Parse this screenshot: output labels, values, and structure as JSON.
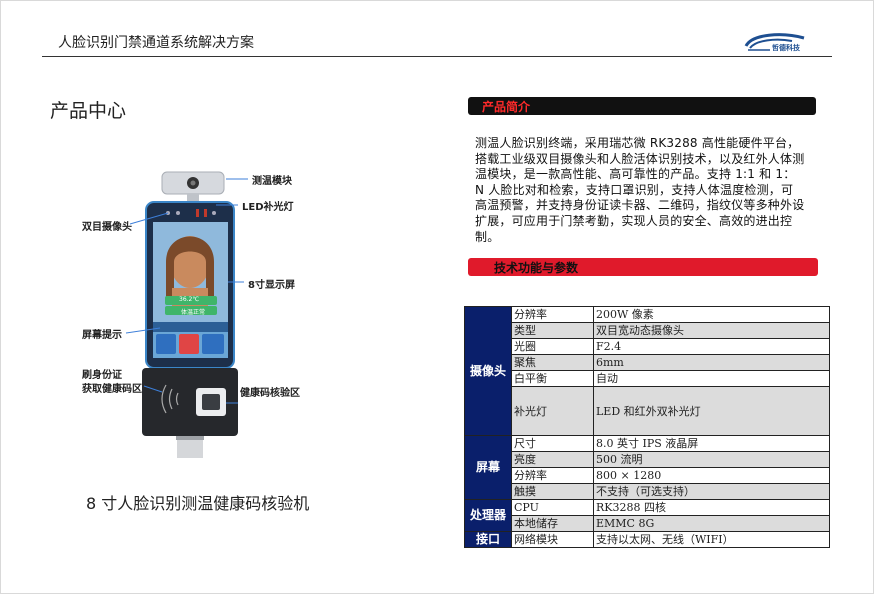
{
  "header": {
    "title": "人脸识别门禁通道系统解决方案",
    "logo_text": "哲德科技"
  },
  "left": {
    "section_title": "产品中心",
    "product_caption": "8 寸人脸识别测温健康码核验机",
    "callouts": {
      "temp_module": "测温模块",
      "led_fill": "LED补光灯",
      "dual_camera": "双目摄像头",
      "display": "8寸显示屏",
      "screen_tip": "屏幕提示",
      "id_card_line1": "刷身份证",
      "id_card_line2": "获取健康码区",
      "health_code": "健康码核验区"
    },
    "device_screen": {
      "temperature": "36.2℃",
      "status": "体温正常"
    }
  },
  "right": {
    "intro_heading": "产品简介",
    "intro_text": "测温人脸识别终端，采用瑞芯微 RK3288 高性能硬件平台，搭载工业级双目摄像头和人脸活体识别技术，以及红外人体测温模块，是一款高性能、高可靠性的产品。支持 1:1 和 1： N 人脸比对和检索，支持口罩识别，支持人体温度检测，可高温预警，并支持身份证读卡器、二维码，指纹仪等多种外设扩展，可应用于门禁考勤，实现人员的安全、高效的进出控制。",
    "spec_heading": "技术功能与参数",
    "specs": {
      "camera": {
        "category": "摄像头",
        "rows": [
          {
            "label": "分辨率",
            "value": "200W 像素"
          },
          {
            "label": "类型",
            "value": "双目宽动态摄像头"
          },
          {
            "label": "光圈",
            "value": "F2.4"
          },
          {
            "label": "聚焦",
            "value": "6mm"
          },
          {
            "label": "白平衡",
            "value": "自动"
          },
          {
            "label": "补光灯",
            "value": "LED  和红外双补光灯"
          }
        ]
      },
      "screen": {
        "category": "屏幕",
        "rows": [
          {
            "label": "尺寸",
            "value": "8.0 英寸  IPS 液晶屏"
          },
          {
            "label": "亮度",
            "value": "500 流明"
          },
          {
            "label": "分辨率",
            "value": "800 × 1280"
          },
          {
            "label": "触摸",
            "value": "不支持（可选支持）"
          }
        ]
      },
      "processor": {
        "category": "处理器",
        "rows": [
          {
            "label": "CPU",
            "value": "RK3288 四核"
          },
          {
            "label": "本地储存",
            "value": "EMMC 8G"
          }
        ]
      },
      "interface": {
        "category": "接口",
        "rows": [
          {
            "label": "网络模块",
            "value": "支持以太网、无线（WIFI）"
          }
        ]
      }
    }
  }
}
